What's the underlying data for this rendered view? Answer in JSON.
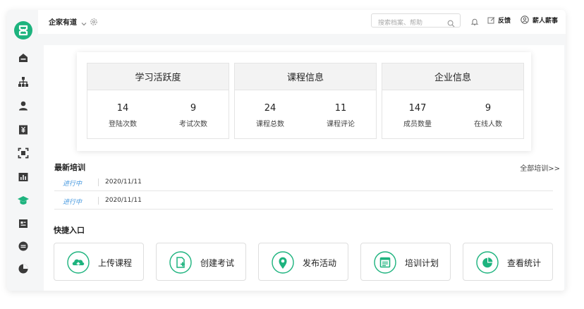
{
  "colors": {
    "accent": "#1db37e",
    "link": "#4a9be0",
    "sidebar_icon": "#3a3a3a"
  },
  "sidebar": {
    "logo": "app-logo-icon",
    "items": [
      {
        "icon": "home-icon"
      },
      {
        "icon": "org-tree-icon"
      },
      {
        "icon": "user-icon"
      },
      {
        "icon": "finance-icon"
      },
      {
        "icon": "scan-icon"
      },
      {
        "icon": "chart-icon"
      },
      {
        "icon": "graduation-cap-icon",
        "active": true
      },
      {
        "icon": "document-icon"
      },
      {
        "icon": "message-icon"
      },
      {
        "icon": "pie-chart-icon"
      }
    ]
  },
  "header": {
    "org_name": "企家有道",
    "search_placeholder": "搜索档案、帮助",
    "feedback_label": "反馈",
    "user_name": "薪人薪事"
  },
  "stats": [
    {
      "title": "学习活跃度",
      "cells": [
        {
          "value": "14",
          "label": "登陆次数"
        },
        {
          "value": "9",
          "label": "考试次数"
        }
      ]
    },
    {
      "title": "课程信息",
      "cells": [
        {
          "value": "24",
          "label": "课程总数"
        },
        {
          "value": "11",
          "label": "课程评论"
        }
      ]
    },
    {
      "title": "企业信息",
      "cells": [
        {
          "value": "147",
          "label": "成员数量"
        },
        {
          "value": "9",
          "label": "在线人数"
        }
      ]
    }
  ],
  "latest_training": {
    "title": "最新培训",
    "all_link": "全部培训>>",
    "rows": [
      {
        "status": "进行中",
        "date": "2020/11/11"
      },
      {
        "status": "进行中",
        "date": "2020/11/11"
      }
    ]
  },
  "quick_entry": {
    "title": "快捷入口",
    "buttons": [
      {
        "icon": "cloud-upload-icon",
        "label": "上传课程"
      },
      {
        "icon": "new-exam-icon",
        "label": "创建考试"
      },
      {
        "icon": "location-pin-icon",
        "label": "发布活动"
      },
      {
        "icon": "calendar-plan-icon",
        "label": "培训计划"
      },
      {
        "icon": "stats-pie-icon",
        "label": "查看统计"
      }
    ]
  }
}
